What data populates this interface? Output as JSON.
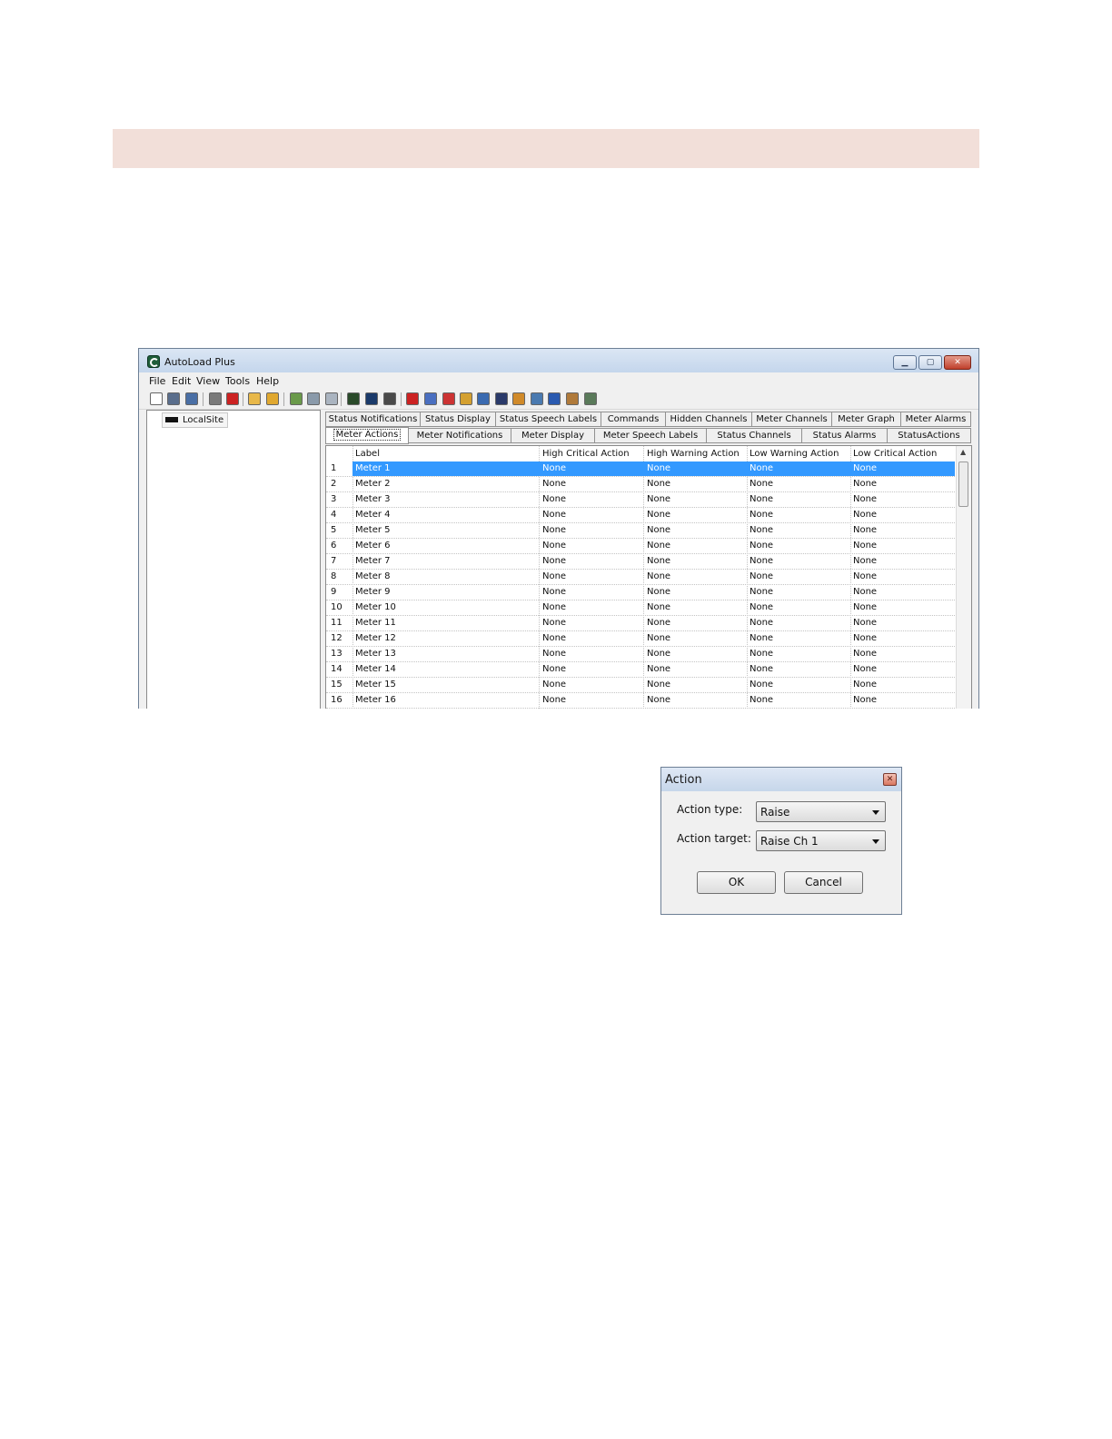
{
  "window": {
    "title": "AutoLoad Plus",
    "min_glyph": "▁",
    "max_glyph": "▢",
    "close_glyph": "✕"
  },
  "menu": [
    "File",
    "Edit",
    "View",
    "Tools",
    "Help"
  ],
  "tree": {
    "site": "LocalSite"
  },
  "tabs_row1": [
    "Status Notifications",
    "Status Display",
    "Status Speech Labels",
    "Commands",
    "Hidden Channels",
    "Meter Channels",
    "Meter Graph",
    "Meter Alarms"
  ],
  "tabs_row2": [
    "Meter Actions",
    "Meter Notifications",
    "Meter Display",
    "Meter Speech Labels",
    "Status Channels",
    "Status Alarms",
    "StatusActions"
  ],
  "active_tab": "Meter Actions",
  "grid": {
    "columns": [
      "Label",
      "High Critical Action",
      "High Warning Action",
      "Low Warning Action",
      "Low Critical Action"
    ],
    "selected_row": 1,
    "rows": [
      [
        "1",
        "Meter 1",
        "None",
        "None",
        "None",
        "None"
      ],
      [
        "2",
        "Meter 2",
        "None",
        "None",
        "None",
        "None"
      ],
      [
        "3",
        "Meter 3",
        "None",
        "None",
        "None",
        "None"
      ],
      [
        "4",
        "Meter 4",
        "None",
        "None",
        "None",
        "None"
      ],
      [
        "5",
        "Meter 5",
        "None",
        "None",
        "None",
        "None"
      ],
      [
        "6",
        "Meter 6",
        "None",
        "None",
        "None",
        "None"
      ],
      [
        "7",
        "Meter 7",
        "None",
        "None",
        "None",
        "None"
      ],
      [
        "8",
        "Meter 8",
        "None",
        "None",
        "None",
        "None"
      ],
      [
        "9",
        "Meter 9",
        "None",
        "None",
        "None",
        "None"
      ],
      [
        "10",
        "Meter 10",
        "None",
        "None",
        "None",
        "None"
      ],
      [
        "11",
        "Meter 11",
        "None",
        "None",
        "None",
        "None"
      ],
      [
        "12",
        "Meter 12",
        "None",
        "None",
        "None",
        "None"
      ],
      [
        "13",
        "Meter 13",
        "None",
        "None",
        "None",
        "None"
      ],
      [
        "14",
        "Meter 14",
        "None",
        "None",
        "None",
        "None"
      ],
      [
        "15",
        "Meter 15",
        "None",
        "None",
        "None",
        "None"
      ],
      [
        "16",
        "Meter 16",
        "None",
        "None",
        "None",
        "None"
      ]
    ]
  },
  "toolbar_icons": [
    {
      "name": "new-file-icon",
      "color": "#ffffff"
    },
    {
      "name": "save-icon",
      "color": "#5a6e8c"
    },
    {
      "name": "save-as-icon",
      "color": "#4a6fa5"
    },
    {
      "name": "filter-icon",
      "color": "#7a7a7a"
    },
    {
      "name": "delete-icon",
      "color": "#cc2222"
    },
    {
      "name": "folder-icon",
      "color": "#e8b84a"
    },
    {
      "name": "open-folder-icon",
      "color": "#e0a830"
    },
    {
      "name": "export-icon",
      "color": "#6a9a4a"
    },
    {
      "name": "import-icon",
      "color": "#8a9aaa"
    },
    {
      "name": "print-preview-icon",
      "color": "#aab4c0"
    },
    {
      "name": "device-add-icon",
      "color": "#2a4a2a"
    },
    {
      "name": "device-send-icon",
      "color": "#1a3a6a"
    },
    {
      "name": "device-remove-icon",
      "color": "#4a4a4a"
    },
    {
      "name": "alarm-bell-icon",
      "color": "#cc2222"
    },
    {
      "name": "grid-icon",
      "color": "#4a6fc0"
    },
    {
      "name": "channels-icon",
      "color": "#cc3333"
    },
    {
      "name": "script-icon",
      "color": "#d4a030"
    },
    {
      "name": "arrow-icon",
      "color": "#3a6ab0"
    },
    {
      "name": "remote-icon",
      "color": "#2a3a6a"
    },
    {
      "name": "tools-icon",
      "color": "#d08a2a"
    },
    {
      "name": "network-icon",
      "color": "#4a7ab0"
    },
    {
      "name": "clock-icon",
      "color": "#2a5ab0"
    },
    {
      "name": "users-icon",
      "color": "#b07a3a"
    },
    {
      "name": "calendar-icon",
      "color": "#5a7a5a"
    }
  ],
  "dialog": {
    "title": "Action",
    "close_glyph": "✕",
    "action_type_label": "Action type:",
    "action_type_value": "Raise",
    "action_target_label": "Action target:",
    "action_target_value": "Raise Ch 1",
    "ok_label": "OK",
    "cancel_label": "Cancel"
  },
  "colors": {
    "banner": "#f2dfd9",
    "selection": "#3399ff"
  }
}
